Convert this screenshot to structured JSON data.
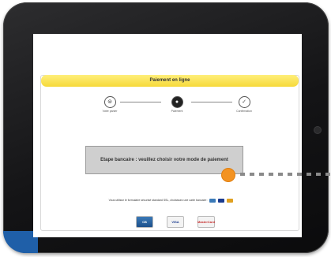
{
  "payment": {
    "title": "Paiement en ligne",
    "message": "Etape bancaire : veuillez choisir votre mode de paiement",
    "info": "Vous utilisez le formulaire sécurisé standard SSL, choisissez une carte bancaire :"
  },
  "steps": [
    {
      "label": "Votre panier",
      "icon": "cart-icon",
      "glyph": "⊜"
    },
    {
      "label": "Paiement",
      "icon": "payment-icon",
      "glyph": "●"
    },
    {
      "label": "Confirmation",
      "icon": "check-icon",
      "glyph": "✓"
    }
  ],
  "cards": [
    {
      "label": "CB",
      "name": "cb-card-button"
    },
    {
      "label": "VISA",
      "name": "visa-card-button"
    },
    {
      "label": "MasterCard",
      "name": "mastercard-card-button"
    }
  ],
  "colors": {
    "header_yellow": "#f6d93a",
    "pointer_orange": "#f39322",
    "tablet_frame": "#141416",
    "accent_blue": "#1f5fa8"
  }
}
